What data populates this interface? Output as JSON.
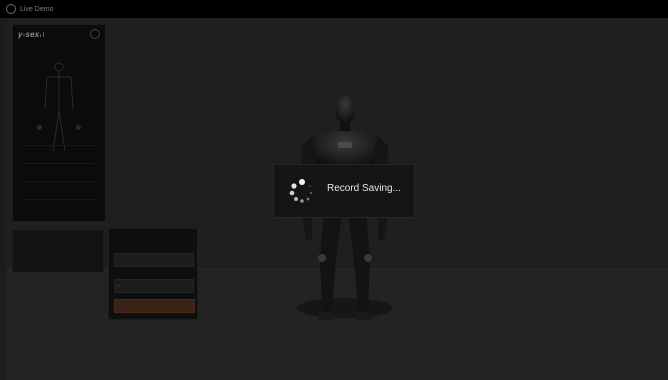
{
  "window": {
    "title": "Live Demo"
  },
  "modal": {
    "message": "Record Saving..."
  },
  "colors": {
    "accent": "#44291c",
    "background": "#1c1c1c",
    "modal_bg": "#151515"
  },
  "icons": {
    "app": "app-icon",
    "settings": "gear-icon",
    "loading": "spinner-icon"
  }
}
